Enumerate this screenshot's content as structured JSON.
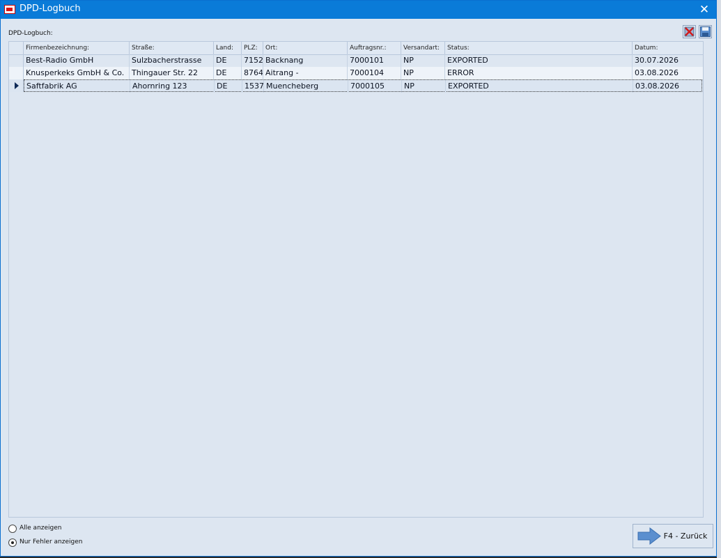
{
  "window": {
    "title": "DPD-Logbuch",
    "close": "✕"
  },
  "section_label": "DPD-Logbuch:",
  "toolbar": {
    "delete_icon": "delete-x-icon",
    "save_icon": "floppy-disk-icon"
  },
  "table": {
    "columns": [
      "Firmenbezeichnung:",
      "Straße:",
      "Land:",
      "PLZ:",
      "Ort:",
      "Auftragsnr.:",
      "Versandart:",
      "Status:",
      "Datum:"
    ],
    "rows": [
      {
        "firma": "Best-Radio GmbH",
        "strasse": "Sulzbacherstrasse",
        "land": "DE",
        "plz": "7152",
        "ort": "Backnang",
        "auftrag": "7000101",
        "versand": "NP",
        "status": "EXPORTED",
        "datum": "30.07.2026"
      },
      {
        "firma": "Knusperkeks GmbH & Co.",
        "strasse": "Thingauer Str. 22",
        "land": "DE",
        "plz": "8764",
        "ort": "Aitrang -",
        "auftrag": "7000104",
        "versand": "NP",
        "status": "ERROR",
        "datum": "03.08.2026"
      },
      {
        "firma": "Saftfabrik AG",
        "strasse": "Ahornring 123",
        "land": "DE",
        "plz": "1537",
        "ort": "Muencheberg",
        "auftrag": "7000105",
        "versand": "NP",
        "status": "EXPORTED",
        "datum": "03.08.2026"
      }
    ],
    "selected_row": 2
  },
  "filters": {
    "show_all": "Alle anzeigen",
    "errors_only": "Nur Fehler anzeigen",
    "selected": "errors_only"
  },
  "buttons": {
    "back": "F4 - Zurück"
  },
  "colors": {
    "titlebar": "#0a7bd8",
    "background": "#dde6f1",
    "arrow": "#5b8fcf"
  }
}
